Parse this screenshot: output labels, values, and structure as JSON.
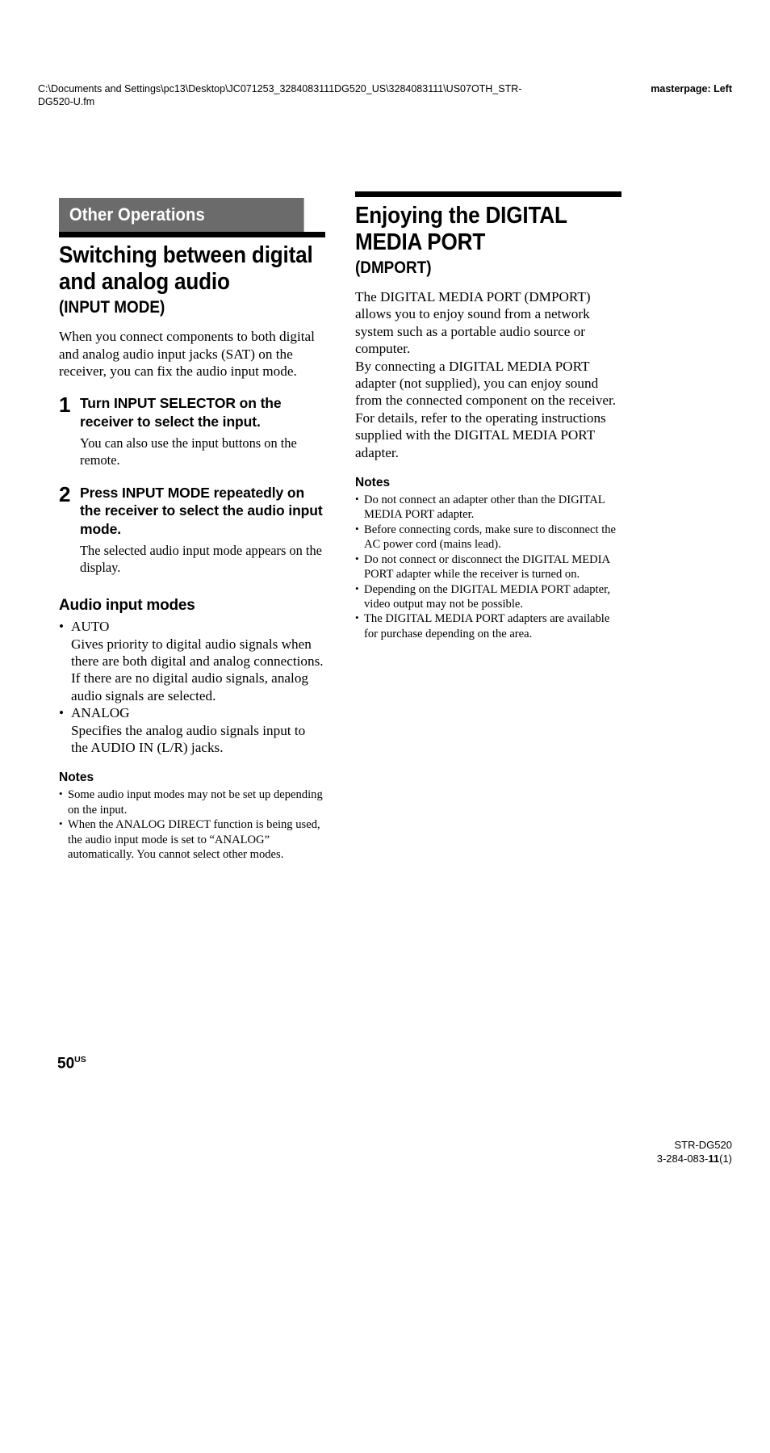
{
  "header": {
    "file_path": "C:\\Documents and Settings\\pc13\\Desktop\\JC071253_3284083111DG520_US\\3284083111\\US07OTH_STR-DG520-U.fm",
    "masterpage": "masterpage: Left"
  },
  "left_column": {
    "section_bar_label": "Other Operations",
    "chapter_title": "Switching between digital and analog audio",
    "chapter_subtitle": "(INPUT MODE)",
    "intro": "When you connect components to both digital and analog audio input jacks (SAT) on the receiver, you can fix the audio input mode.",
    "steps": [
      {
        "number": "1",
        "title": "Turn INPUT SELECTOR on the receiver to select the input.",
        "description": "You can also use the input buttons on the remote."
      },
      {
        "number": "2",
        "title": "Press INPUT MODE repeatedly on the receiver to select the audio input mode.",
        "description": "The selected audio input mode appears on the display."
      }
    ],
    "modes_heading": "Audio input modes",
    "modes": [
      {
        "name": "AUTO",
        "description": "Gives priority to digital audio signals when there are both digital and analog connections. If there are no digital audio signals, analog audio signals are selected."
      },
      {
        "name": "ANALOG",
        "description": "Specifies the analog audio signals input to the AUDIO IN (L/R) jacks."
      }
    ],
    "notes_heading": "Notes",
    "notes": [
      "Some audio input modes may not be set up depending on the input.",
      "When the ANALOG DIRECT function is being used, the audio input mode is set to “ANALOG” automatically. You cannot select other modes."
    ]
  },
  "right_column": {
    "chapter_title": "Enjoying the DIGITAL MEDIA PORT",
    "chapter_subtitle": "(DMPORT)",
    "paragraphs": [
      "The DIGITAL MEDIA PORT (DMPORT) allows you to enjoy sound from a network system such as a portable audio source or computer.",
      "By connecting a DIGITAL MEDIA PORT adapter (not supplied), you can enjoy sound from the connected component on the receiver.",
      "For details, refer to the operating instructions supplied with the DIGITAL MEDIA PORT adapter."
    ],
    "notes_heading": "Notes",
    "notes": [
      "Do not connect an adapter other than the DIGITAL MEDIA PORT adapter.",
      "Before connecting cords, make sure to disconnect the AC power cord (mains lead).",
      "Do not connect or disconnect the DIGITAL MEDIA PORT adapter while the receiver is turned on.",
      "Depending on the DIGITAL MEDIA PORT adapter, video output may not be possible.",
      "The DIGITAL MEDIA PORT adapters are available for purchase depending on the area."
    ]
  },
  "footer": {
    "page_number": "50",
    "page_number_suffix": "US",
    "model": "STR-DG520",
    "doc_number_prefix": "3-284-083-",
    "doc_number_bold": "11",
    "doc_number_suffix": "(1)"
  },
  "symbols": {
    "bullet": "•"
  },
  "colors": {
    "section_bar_bg": "#6b6b6b",
    "rule": "#000000",
    "text": "#000000",
    "page_bg": "#ffffff"
  }
}
